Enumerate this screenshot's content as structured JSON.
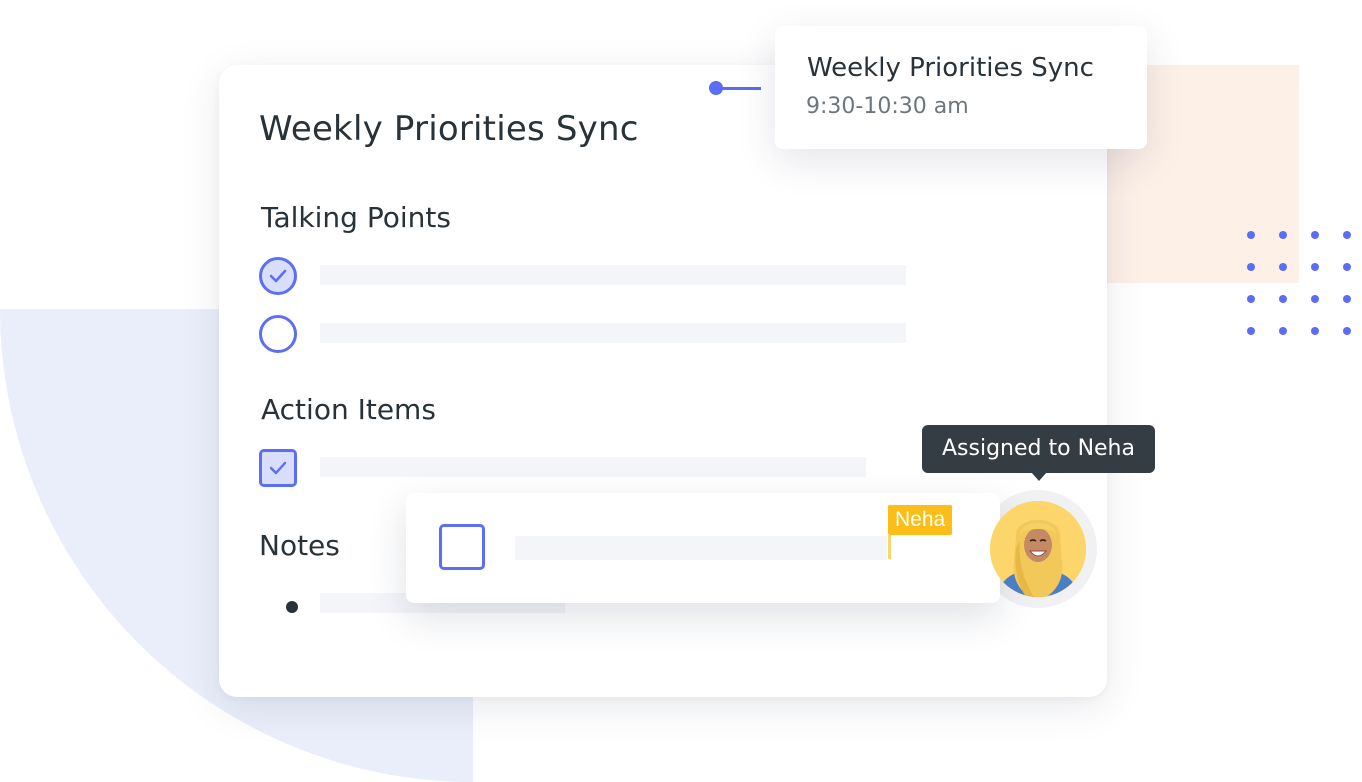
{
  "colors": {
    "accent": "#5b6cf6",
    "accent_light": "#d9defc",
    "text_primary": "#283238",
    "text_secondary": "#6d767c",
    "placeholder": "#f4f5f9",
    "tag_yellow": "#fbbd17",
    "tooltip_bg": "#353d44",
    "bg_lavender": "#eaeefa",
    "bg_peach": "#fdf0e7"
  },
  "main_card": {
    "title": "Weekly Priorities Sync",
    "sections": {
      "talking_points": {
        "title": "Talking Points",
        "items": [
          {
            "checked": true,
            "icon": "check-circle-icon"
          },
          {
            "checked": false,
            "icon": "circle-icon"
          }
        ]
      },
      "action_items": {
        "title": "Action Items",
        "items": [
          {
            "checked": true,
            "icon": "checkbox-checked-icon"
          }
        ]
      },
      "notes": {
        "title": "Notes",
        "items": [
          {
            "icon": "bullet-icon"
          }
        ]
      }
    }
  },
  "event_card": {
    "title": "Weekly Priorities Sync",
    "time": "9:30-10:30 am"
  },
  "task_card": {
    "checked": false,
    "assignee_tag": "Neha",
    "avatar": "avatar-neha"
  },
  "tooltip": {
    "text": "Assigned to Neha"
  }
}
